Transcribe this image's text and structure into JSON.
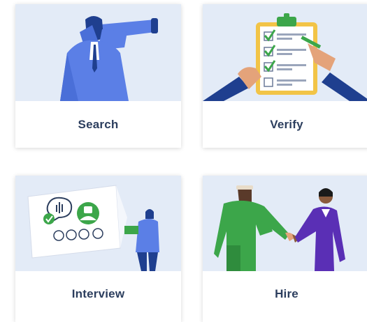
{
  "colors": {
    "art_background": "#e3ebf7",
    "label_text": "#2c3e5e",
    "figure_blue": "#5b7fe6",
    "figure_navy": "#1f3f8f",
    "checklist_gold": "#f2c447",
    "success_green": "#3ca64a",
    "hire_purple": "#5a2fb5"
  },
  "cards": [
    {
      "label": "Search",
      "icon": "binoculars-searcher-icon"
    },
    {
      "label": "Verify",
      "icon": "clipboard-checklist-icon"
    },
    {
      "label": "Interview",
      "icon": "video-interview-icon"
    },
    {
      "label": "Hire",
      "icon": "handshake-icon"
    }
  ]
}
